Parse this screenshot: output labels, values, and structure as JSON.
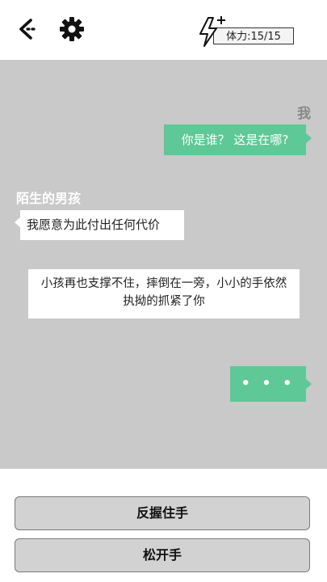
{
  "header": {
    "back_icon": "back-arrow-icon",
    "settings_icon": "gear-icon",
    "stamina_icon": "lightning-plus-icon",
    "stamina_text": "体力:15/15"
  },
  "chat": {
    "me_name": "我",
    "me_message": "你是谁？ 这是在哪?",
    "npc_name": "陌生的男孩",
    "npc_message": "我愿意为此付出任何代价",
    "narration": "小孩再也支撑不住，摔倒在一旁，小小的手依然执拗的抓紧了你",
    "typing_indicator": "• • •"
  },
  "choices": [
    {
      "label": "反握住手"
    },
    {
      "label": "松开手"
    }
  ],
  "colors": {
    "accent_green": "#5ec896",
    "chat_bg": "#c9c9c9"
  }
}
